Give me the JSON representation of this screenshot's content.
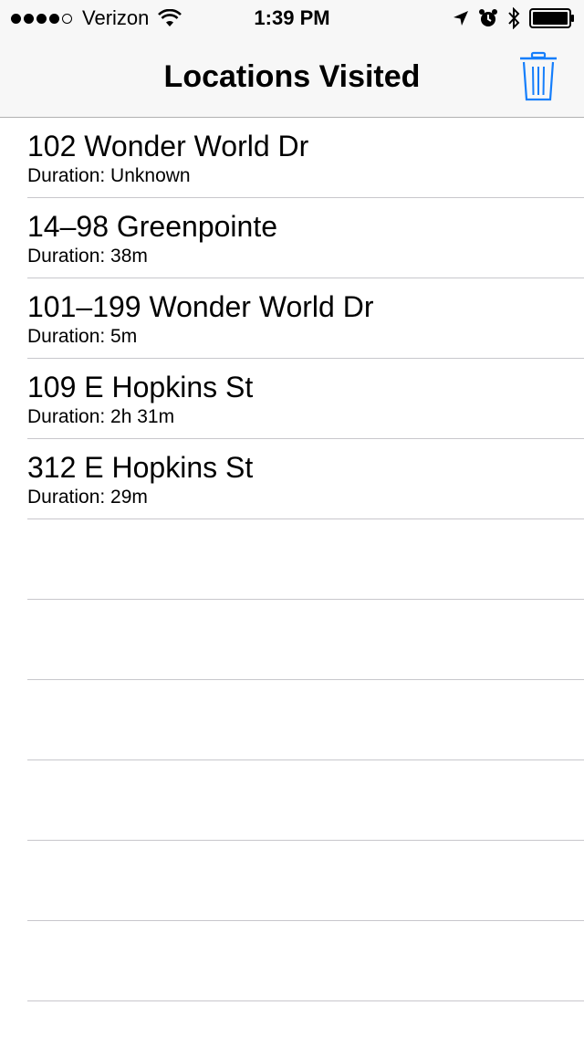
{
  "status_bar": {
    "carrier": "Verizon",
    "time": "1:39 PM",
    "signal_bars": 4,
    "signal_total": 5
  },
  "nav": {
    "title": "Locations Visited",
    "trash_icon": "trash-icon",
    "accent_color": "#157efb"
  },
  "locations": [
    {
      "name": "102 Wonder World Dr",
      "duration": "Duration: Unknown"
    },
    {
      "name": "14–98 Greenpointe",
      "duration": "Duration: 38m"
    },
    {
      "name": "101–199 Wonder World Dr",
      "duration": "Duration: 5m"
    },
    {
      "name": "109 E Hopkins St",
      "duration": "Duration: 2h 31m"
    },
    {
      "name": "312 E Hopkins St",
      "duration": "Duration: 29m"
    }
  ]
}
